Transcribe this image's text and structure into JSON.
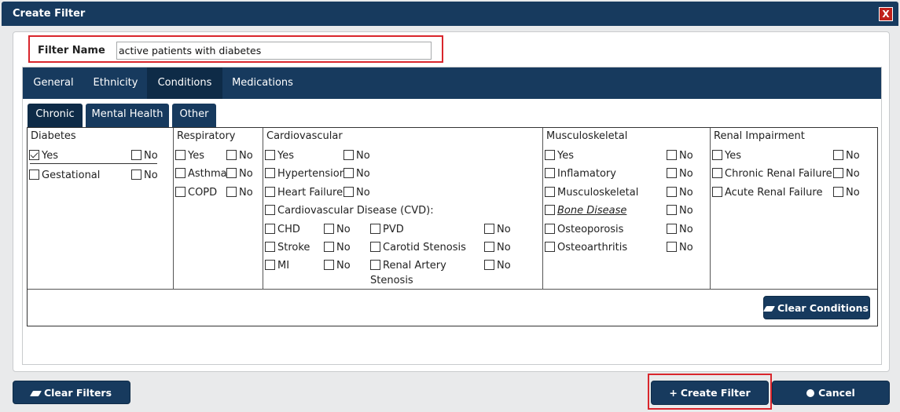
{
  "dialog": {
    "title": "Create Filter",
    "close_label": "X"
  },
  "filter_name": {
    "label": "Filter Name",
    "value": "active patients with diabetes"
  },
  "tabs": [
    {
      "label": "General",
      "active": false
    },
    {
      "label": "Ethnicity",
      "active": false
    },
    {
      "label": "Conditions",
      "active": true
    },
    {
      "label": "Medications",
      "active": false
    }
  ],
  "subtabs": [
    {
      "label": "Chronic",
      "active": true
    },
    {
      "label": "Mental Health",
      "active": false
    },
    {
      "label": "Other",
      "active": false
    }
  ],
  "conditions": {
    "diabetes": {
      "title": "Diabetes",
      "yes": "Yes",
      "yes_checked": true,
      "no": "No",
      "gestational": "Gestational",
      "gestational_no": "No"
    },
    "respiratory": {
      "title": "Respiratory",
      "yes": "Yes",
      "no": "No",
      "asthma": "Asthma",
      "asthma_no": "No",
      "copd": "COPD",
      "copd_no": "No"
    },
    "cardiovascular": {
      "title": "Cardiovascular",
      "yes": "Yes",
      "no": "No",
      "hypertension": "Hypertension",
      "hypertension_no": "No",
      "heart_failure": "Heart Failure",
      "heart_failure_no": "No",
      "cvd": "Cardiovascular Disease (CVD):",
      "chd": "CHD",
      "chd_no": "No",
      "pvd": "PVD",
      "pvd_no": "No",
      "stroke": "Stroke",
      "stroke_no": "No",
      "carotid": "Carotid Stenosis",
      "carotid_no": "No",
      "mi": "MI",
      "mi_no": "No",
      "renal_artery_1": "Renal Artery",
      "renal_artery_2": "Stenosis",
      "renal_artery_no": "No"
    },
    "musculoskeletal": {
      "title": "Musculoskeletal",
      "yes": "Yes",
      "no": "No",
      "inflamatory": "Inflamatory",
      "inflamatory_no": "No",
      "musculo": "Musculoskeletal",
      "musculo_no": "No",
      "bone": "Bone Disease",
      "bone_no": "No",
      "osteoporosis": "Osteoporosis",
      "osteoporosis_no": "No",
      "osteoarthritis": "Osteoarthritis",
      "osteoarthritis_no": "No"
    },
    "renal": {
      "title": "Renal Impairment",
      "yes": "Yes",
      "no": "No",
      "chronic": "Chronic Renal Failure",
      "chronic_no": "No",
      "acute": "Acute Renal Failure",
      "acute_no": "No"
    }
  },
  "buttons": {
    "clear_conditions": "Clear Conditions",
    "clear_filters": "Clear Filters",
    "create_filter": "Create Filter",
    "cancel": "Cancel"
  },
  "icons": {
    "eraser": "eraser-icon",
    "plus": "plus-icon",
    "circle": "circle-icon",
    "close": "close-icon"
  },
  "colors": {
    "primary": "#173a5e",
    "primary_active": "#0e2b47",
    "highlight": "#d9262c",
    "close": "#c0211b"
  }
}
